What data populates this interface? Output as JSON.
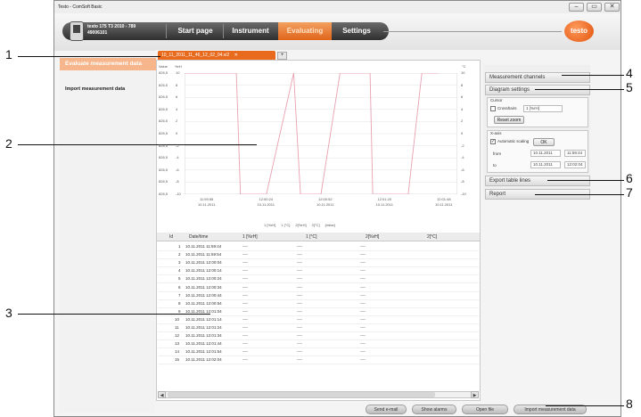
{
  "window": {
    "title": "Testo - ComSoft Basic",
    "controls": [
      "–",
      "▭",
      "✕"
    ]
  },
  "header": {
    "device_name": "testo 175 T3 2010 - 789",
    "device_serial": "49006101",
    "nav": [
      "Start page",
      "Instrument",
      "Evaluating",
      "Settings"
    ],
    "active_nav": "Evaluating",
    "logo": "testo"
  },
  "left_panel": {
    "items": [
      "Evaluate measurement data",
      "Import measurement data"
    ]
  },
  "tabs": {
    "file_tab": "10_11_2011_11_46_12_02_04.vi2",
    "close": "✕",
    "add": "+"
  },
  "chart_data": {
    "type": "line",
    "title": "",
    "left_axis_label": "%rH",
    "left_axis_outer_label": "Value",
    "right_axis_label": "°C",
    "left_ticks": [
      "10",
      "8",
      "6",
      "4",
      "2",
      "0",
      "-2",
      "-4",
      "-6",
      "-8",
      "-10"
    ],
    "outer_left_ticks": [
      "826,5",
      "826,5",
      "826,5",
      "826,5",
      "826,5",
      "826,5",
      "826,5",
      "826,5",
      "826,5",
      "826,5",
      "826,5"
    ],
    "right_ticks": [
      "10",
      "8",
      "6",
      "4",
      "2",
      "0",
      "-2",
      "-4",
      "-6",
      "-8",
      "-10"
    ],
    "x_ticks": [
      {
        "time": "11:59:55",
        "date": "10.11.2011"
      },
      {
        "time": "12:00:24",
        "date": "10.11.2011"
      },
      {
        "time": "12:00:52",
        "date": "10.11.2011"
      },
      {
        "time": "12:01:20",
        "date": "10.11.2011"
      },
      {
        "time": "12:01:48",
        "date": "10.11.2011"
      }
    ],
    "ylim": [
      -10,
      10
    ],
    "legend": [
      "1 [%rH]",
      "1 [°C]",
      "2[%rH]",
      "2[°C]",
      "[mbar]"
    ],
    "series_color": "#e8a0b0",
    "points": [
      [
        0,
        10
      ],
      [
        0.19,
        10
      ],
      [
        0.205,
        -10
      ],
      [
        0.3,
        -10
      ],
      [
        0.4,
        10
      ],
      [
        0.425,
        -10
      ],
      [
        0.5,
        -10
      ],
      [
        0.57,
        10
      ],
      [
        0.68,
        10
      ],
      [
        0.69,
        -10
      ],
      [
        0.82,
        -10
      ],
      [
        0.87,
        10
      ],
      [
        0.93,
        10
      ]
    ]
  },
  "table": {
    "columns": [
      "Id",
      "Date/time",
      "1 [%rH]",
      "1 [°C]",
      "2[%rH]",
      "2[°C]"
    ],
    "rows": [
      [
        "1",
        "10.11.2011 11:59:44",
        "----",
        "----",
        "----"
      ],
      [
        "2",
        "10.11.2011 11:59:54",
        "----",
        "----",
        "----"
      ],
      [
        "3",
        "10.11.2011 12:00:04",
        "----",
        "----",
        "----"
      ],
      [
        "4",
        "10.11.2011 12:00:14",
        "----",
        "----",
        "----"
      ],
      [
        "5",
        "10.11.2011 12:00:24",
        "----",
        "----",
        "----"
      ],
      [
        "6",
        "10.11.2011 12:00:34",
        "----",
        "----",
        "----"
      ],
      [
        "7",
        "10.11.2011 12:00:44",
        "----",
        "----",
        "----"
      ],
      [
        "8",
        "10.11.2011 12:00:54",
        "----",
        "----",
        "----"
      ],
      [
        "9",
        "10.11.2011 12:01:04",
        "----",
        "----",
        "----"
      ],
      [
        "10",
        "10.11.2011 12:01:14",
        "----",
        "----",
        "----"
      ],
      [
        "11",
        "10.11.2011 12:01:24",
        "----",
        "----",
        "----"
      ],
      [
        "12",
        "10.11.2011 12:01:34",
        "----",
        "----",
        "----"
      ],
      [
        "13",
        "10.11.2011 12:01:44",
        "----",
        "----",
        "----"
      ],
      [
        "14",
        "10.11.2011 12:01:54",
        "----",
        "----",
        "----"
      ],
      [
        "15",
        "10.11.2011 12:02:04",
        "----",
        "----",
        "----"
      ]
    ]
  },
  "right_panel": {
    "measurement_channels": "Measurement channels",
    "diagram_settings": "Diagram settings",
    "cursor_label": "Cursor",
    "crosshairs_label": "Crosshairs",
    "crosshairs_select": "1 [%rH]",
    "reset_zoom": "Reset zoom",
    "x_axis_label": "X-axis",
    "automatic_scaling": "Automatic scaling",
    "ok": "OK",
    "from_label": "from",
    "from_date": "10.11.2011",
    "from_time": "11:59:44",
    "to_label": "to",
    "to_date": "10.11.2011",
    "to_time": "12:02:04",
    "export_table_lines": "Export table lines",
    "report": "Report"
  },
  "bottom_buttons": [
    "Send e-mail",
    "Show alarms",
    "Open file",
    "Import measurement data"
  ],
  "callouts": [
    "1",
    "2",
    "3",
    "4",
    "5",
    "6",
    "7",
    "8"
  ]
}
